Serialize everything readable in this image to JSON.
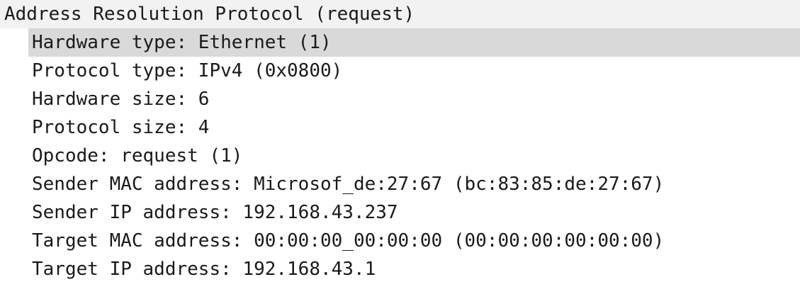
{
  "header": {
    "label": "Address Resolution Protocol (request)"
  },
  "fields": [
    {
      "text": "Hardware type: Ethernet (1)",
      "selected": true
    },
    {
      "text": "Protocol type: IPv4 (0x0800)",
      "selected": false
    },
    {
      "text": "Hardware size: 6",
      "selected": false
    },
    {
      "text": "Protocol size: 4",
      "selected": false
    },
    {
      "text": "Opcode: request (1)",
      "selected": false
    },
    {
      "text": "Sender MAC address: Microsof_de:27:67 (bc:83:85:de:27:67)",
      "selected": false
    },
    {
      "text": "Sender IP address: 192.168.43.237",
      "selected": false
    },
    {
      "text": "Target MAC address: 00:00:00_00:00:00 (00:00:00:00:00:00)",
      "selected": false
    },
    {
      "text": "Target IP address: 192.168.43.1",
      "selected": false
    }
  ]
}
